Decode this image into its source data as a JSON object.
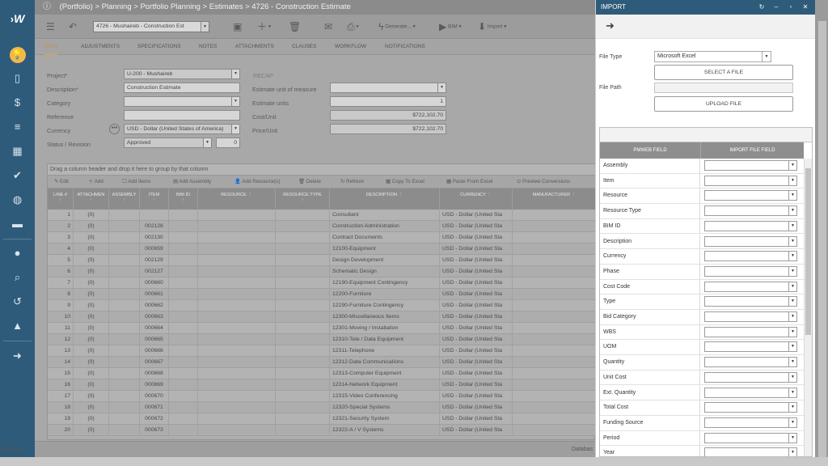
{
  "breadcrumb": "(Portfolio) > Planning > Portfolio Planning > Estimates > 4726 - Construction Estimate",
  "record_selector": "4726 - Mushaireb - Construction Est",
  "toolbar": {
    "generate": "Generate...",
    "bim": "BIM",
    "import": "Import"
  },
  "tabs": [
    "MAIN",
    "ADJUSTMENTS",
    "SPECIFICATIONS",
    "NOTES",
    "ATTACHMENTS",
    "CLAUSES",
    "WORKFLOW",
    "NOTIFICATIONS"
  ],
  "form": {
    "project_label": "Project*",
    "project_value": "U-200 - Mushaireb",
    "description_label": "Description*",
    "description_value": "Construction Estimate",
    "category_label": "Category",
    "reference_label": "Reference",
    "currency_label": "Currency",
    "currency_value": "USD - Dollar (United States of America)",
    "status_label": "Status / Revision",
    "status_value": "Approved",
    "revision_value": "0",
    "recap_label": "RECAP",
    "unit_measure_label": "Estimate unit of measure",
    "units_label": "Estimate units",
    "units_value": "1",
    "cost_unit_label": "Cost/Unit",
    "cost_unit_value": "$722,102.70",
    "price_unit_label": "Price/Unit",
    "price_unit_value": "$722,102.70"
  },
  "grid": {
    "group_hint": "Drag a column header and drop it here to group by that column",
    "toolbar": [
      "Edit",
      "Add",
      "Add Items",
      "Add Assembly",
      "Add Resource(s)",
      "Delete",
      "Refresh",
      "Copy To Excel",
      "Paste From Excel",
      "Preview Conversions"
    ],
    "headers": [
      "LINE #",
      "ATTACHMEN",
      "ASSEMBLY",
      "ITEM",
      "BIM ID",
      "RESOURCE",
      "RESOURCE TYPE",
      "DESCRIPTION",
      "CURRENCY",
      "MANUFACTURER"
    ],
    "attach_text": "(0)",
    "currency_text": "USD - Dollar (United Sta",
    "rows": [
      {
        "line": "1",
        "item": "",
        "desc": "Consultant"
      },
      {
        "line": "2",
        "item": "002128",
        "desc": "Construction Administration"
      },
      {
        "line": "3",
        "item": "002130",
        "desc": "Contract Documents"
      },
      {
        "line": "4",
        "item": "000659",
        "desc": "12100-Equipment"
      },
      {
        "line": "5",
        "item": "002129",
        "desc": "Design Development"
      },
      {
        "line": "6",
        "item": "002127",
        "desc": "Schematic Design"
      },
      {
        "line": "7",
        "item": "000660",
        "desc": "12190-Equipment Contingency"
      },
      {
        "line": "8",
        "item": "000661",
        "desc": "12200-Furniture"
      },
      {
        "line": "9",
        "item": "000662",
        "desc": "12290-Furniture Contingency"
      },
      {
        "line": "10",
        "item": "000663",
        "desc": "12300-Miscellaneous Items"
      },
      {
        "line": "11",
        "item": "000664",
        "desc": "12301-Moving / Installation"
      },
      {
        "line": "12",
        "item": "000665",
        "desc": "12310-Tele / Data Equipment"
      },
      {
        "line": "13",
        "item": "000666",
        "desc": "12311-Telephone"
      },
      {
        "line": "14",
        "item": "000667",
        "desc": "12312-Data Communications"
      },
      {
        "line": "15",
        "item": "000668",
        "desc": "12313-Computer Equipment"
      },
      {
        "line": "16",
        "item": "000669",
        "desc": "12314-Network Equipment"
      },
      {
        "line": "17",
        "item": "000670",
        "desc": "12315-Video Conferencing"
      },
      {
        "line": "18",
        "item": "000671",
        "desc": "12320-Special Systems"
      },
      {
        "line": "19",
        "item": "000672",
        "desc": "12321-Security System"
      },
      {
        "line": "20",
        "item": "000673",
        "desc": "12322-A / V Systems"
      }
    ]
  },
  "status": {
    "created": "Created:",
    "database": "Databas"
  },
  "import_panel": {
    "title": "IMPORT",
    "file_type_label": "File Type",
    "file_type_value": "Microsoft Excel",
    "select_file": "SELECT A FILE",
    "file_path_label": "File Path",
    "upload_file": "UPLOAD FILE",
    "col_pmweb": "PMWEB FIELD",
    "col_import": "IMPORT FILE FIELD",
    "fields": [
      "Assembly",
      "Item",
      "Resource",
      "Resource Type",
      "BIM ID",
      "Description",
      "Currency",
      "Phase",
      "Cost Code",
      "Type",
      "Bid Category",
      "WBS",
      "UOM",
      "Quantity",
      "Unit Cost",
      "Ext. Quantity",
      "Total Cost",
      "Funding Source",
      "Period",
      "Year"
    ]
  }
}
